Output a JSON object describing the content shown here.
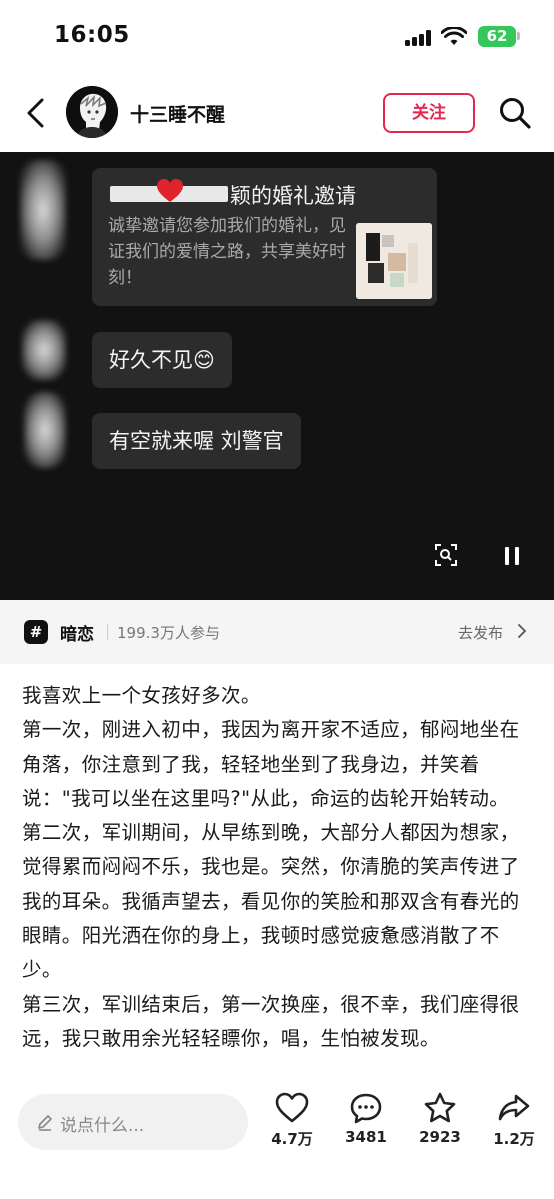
{
  "status_bar": {
    "time": "16:05",
    "battery": "62"
  },
  "header": {
    "username": "十三睡不醒",
    "follow_label": "关注"
  },
  "video": {
    "invite_card": {
      "title_suffix": "颖的婚礼邀请",
      "description": "诚挚邀请您参加我们的婚礼，见证我们的爱情之路，共享美好时刻！"
    },
    "messages": [
      "好久不见😊",
      "有空就来喔 刘警官"
    ]
  },
  "topic": {
    "name": "暗恋",
    "participants": "199.3万人参与",
    "post_link": "去发布"
  },
  "post_paragraphs": [
    "我喜欢上一个女孩好多次。",
    "第一次，刚进入初中，我因为离开家不适应，郁闷地坐在角落，你注意到了我，轻轻地坐到了我身边，并笑着说：\"我可以坐在这里吗?\"从此，命运的齿轮开始转动。",
    "第二次，军训期间，从早练到晚，大部分人都因为想家，觉得累而闷闷不乐，我也是。突然，你清脆的笑声传进了我的耳朵。我循声望去，看见你的笑脸和那双含有春光的眼睛。阳光洒在你的身上，我顿时感觉疲惫感消散了不少。",
    "第三次，军训结束后，第一次换座，很不幸，我们座得很远，我只敢用余光轻轻瞟你，唱，生怕被发现。"
  ],
  "bottom_bar": {
    "comment_placeholder": "说点什么...",
    "likes": "4.7万",
    "comments": "3481",
    "favorites": "2923",
    "shares": "1.2万"
  }
}
